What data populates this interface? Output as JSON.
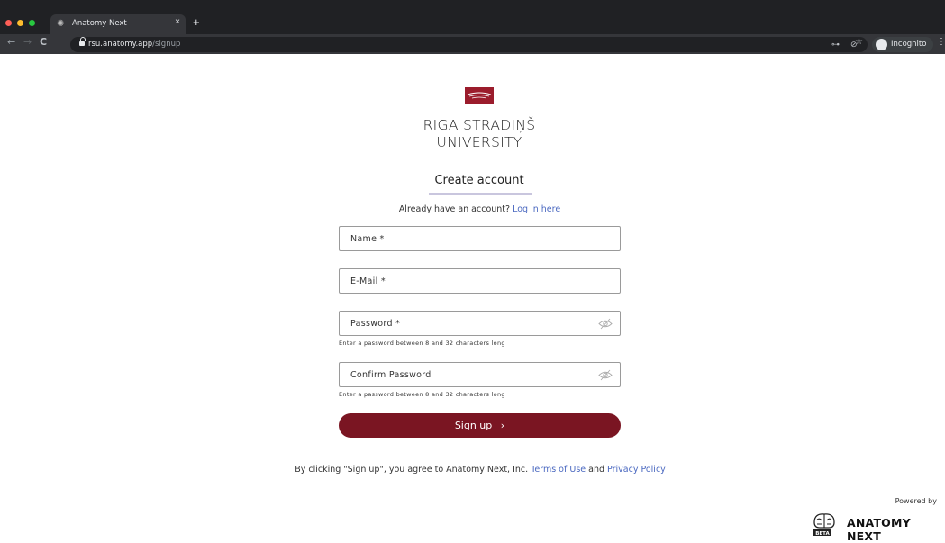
{
  "browser": {
    "tab_title": "Anatomy Next",
    "tab_close": "×",
    "new_tab": "+",
    "url_host": "rsu.anatomy.app",
    "url_path": "/signup",
    "back": "←",
    "forward": "→",
    "reload": "C",
    "incognito_label": "Incognito",
    "menu": "⋮",
    "icons": [
      "key-icon",
      "eye-off-icon",
      "star-icon"
    ]
  },
  "university": {
    "line1": "RIGA STRADIŅŠ",
    "line2": "UNIVERSITY"
  },
  "form": {
    "heading": "Create account",
    "already_text": "Already have an account?",
    "login_link": "Log in here",
    "name_label": "Name *",
    "email_label": "E-Mail *",
    "password_label": "Password *",
    "password_hint": "Enter a password between 8 and 32 characters long",
    "confirm_label": "Confirm Password",
    "confirm_hint": "Enter a password between 8 and 32 characters long",
    "signup_button": "Sign up",
    "signup_arrow": "›"
  },
  "footer": {
    "terms_prefix": "By clicking \"Sign up\", you agree to Anatomy Next, Inc.",
    "terms_link": "Terms of Use",
    "and": "and",
    "privacy_link": "Privacy Policy",
    "powered_by": "Powered by",
    "brand_name": "ANATOMY NEXT",
    "beta_badge": "BETA"
  },
  "colors": {
    "accent": "#7a1522",
    "link": "#4a68c0",
    "heading_underline": "#c9c6de"
  }
}
